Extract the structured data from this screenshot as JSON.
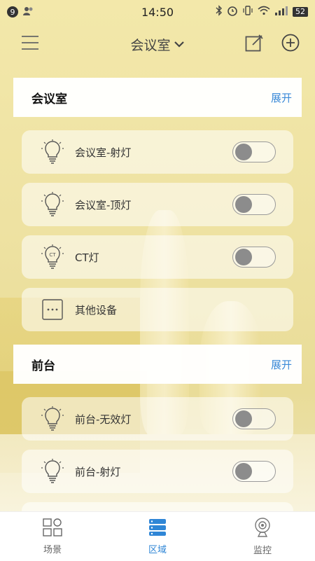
{
  "status_bar": {
    "badge": "9",
    "time": "14:50",
    "battery": "52"
  },
  "header": {
    "title": "会议室",
    "icons": [
      "menu-icon",
      "chevron-down-icon",
      "edit-icon",
      "add-circle-icon"
    ]
  },
  "sections": [
    {
      "title": "会议室",
      "expand_label": "展开",
      "devices": [
        {
          "name": "会议室-射灯",
          "icon": "bulb-icon",
          "toggle": "off"
        },
        {
          "name": "会议室-顶灯",
          "icon": "bulb-icon",
          "toggle": "off"
        },
        {
          "name": "CT灯",
          "icon": "ct-bulb-icon",
          "icon_text": "CT",
          "toggle": "off"
        },
        {
          "name": "其他设备",
          "icon": "other-device-icon"
        }
      ]
    },
    {
      "title": "前台",
      "expand_label": "展开",
      "devices": [
        {
          "name": "前台-无效灯",
          "icon": "bulb-icon",
          "toggle": "off"
        },
        {
          "name": "前台-射灯",
          "icon": "bulb-icon",
          "toggle": "off"
        }
      ]
    }
  ],
  "bottom_nav": [
    {
      "label": "场景",
      "icon": "scene-grid-icon",
      "active": false
    },
    {
      "label": "区域",
      "icon": "area-stack-icon",
      "active": true
    },
    {
      "label": "监控",
      "icon": "camera-icon",
      "active": false
    }
  ],
  "colors": {
    "accent": "#2f86d6",
    "expand_link": "#3b8ad8",
    "background": "#efe3a2"
  }
}
